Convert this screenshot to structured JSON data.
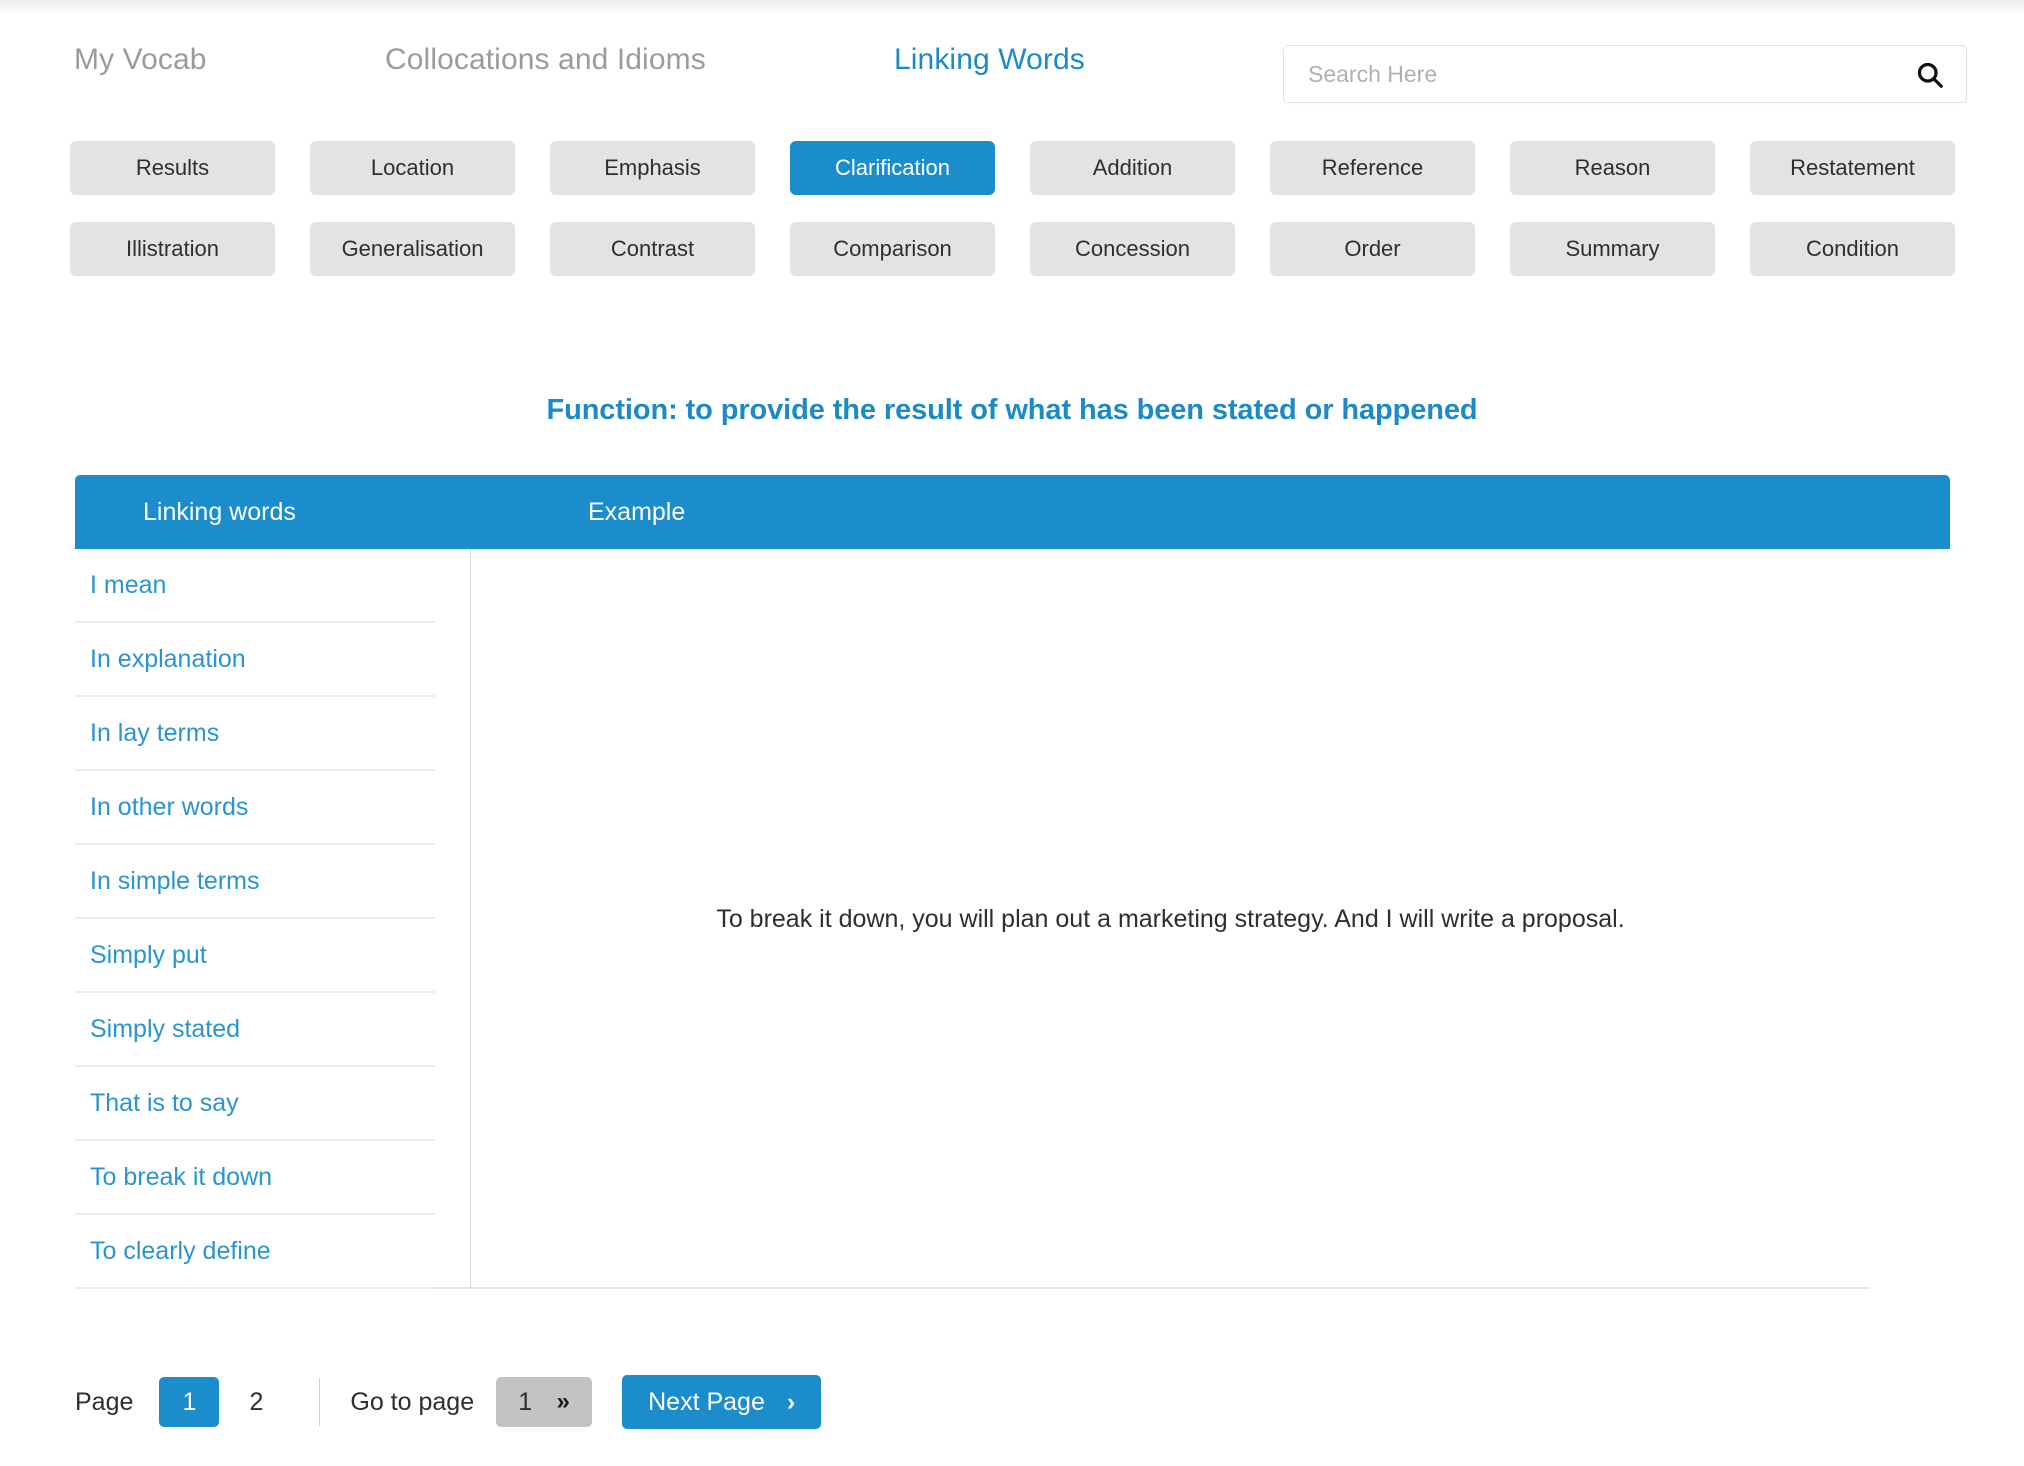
{
  "nav": {
    "items": [
      {
        "label": "My Vocab",
        "active": false
      },
      {
        "label": "Collocations and Idioms",
        "active": false
      },
      {
        "label": "Linking Words",
        "active": true
      }
    ]
  },
  "search": {
    "placeholder": "Search Here",
    "value": "",
    "icon": "search-icon"
  },
  "categories": {
    "active": "Clarification",
    "items": [
      "Results",
      "Location",
      "Emphasis",
      "Clarification",
      "Addition",
      "Reference",
      "Reason",
      "Restatement",
      "Illistration",
      "Generalisation",
      "Contrast",
      "Comparison",
      "Concession",
      "Order",
      "Summary",
      "Condition"
    ]
  },
  "function_title": "Function: to provide the result of what has been stated or happened",
  "table": {
    "headers": [
      "Linking words",
      "Example"
    ],
    "rows": [
      "I mean",
      "In explanation",
      "In lay terms",
      "In other words",
      "In simple terms",
      "Simply put",
      "Simply stated",
      "That is to say",
      "To break it down",
      "To clearly define"
    ],
    "example": "To break it down, you will plan out a marketing strategy. And I will write a proposal."
  },
  "pagination": {
    "page_label": "Page",
    "pages": [
      "1",
      "2"
    ],
    "current_page": "1",
    "goto_label": "Go to page",
    "goto_value": "1",
    "goto_chevron": "»",
    "next_label": "Next Page",
    "next_chevron": "›"
  },
  "colors": {
    "accent": "#1b8ccc",
    "link": "#2a94cf",
    "nav_inactive": "#9b9b9b",
    "button_bg": "#e3e3e3",
    "goto_bg": "#c3c3c3"
  }
}
